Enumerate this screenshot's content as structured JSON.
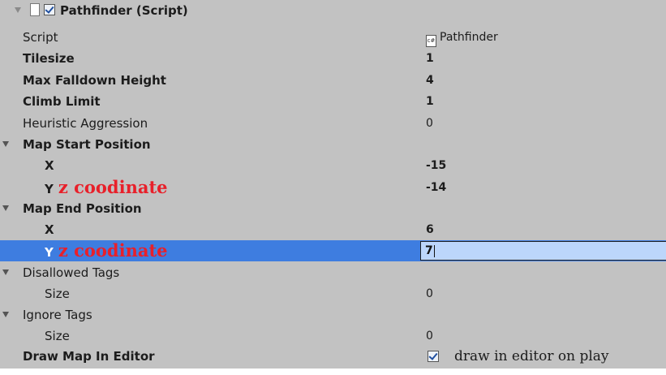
{
  "component": {
    "title": "Pathfinder (Script)"
  },
  "rows": {
    "script": {
      "label": "Script",
      "value": "Pathfinder"
    },
    "tilesize": {
      "label": "Tilesize",
      "value": "1"
    },
    "max_falldown": {
      "label": "Max Falldown Height",
      "value": "4"
    },
    "climb_limit": {
      "label": "Climb Limit",
      "value": "1"
    },
    "heuristic": {
      "label": "Heuristic Aggression",
      "value": "0"
    },
    "map_start": {
      "label": "Map Start Position"
    },
    "start_x": {
      "label": "X",
      "value": "-15"
    },
    "start_y": {
      "label": "Y",
      "value": "-14",
      "note": "z coodinate"
    },
    "map_end": {
      "label": "Map End Position"
    },
    "end_x": {
      "label": "X",
      "value": "6"
    },
    "end_y": {
      "label": "Y",
      "value": "7",
      "note": "z coodinate"
    },
    "disallowed_tags": {
      "label": "Disallowed Tags"
    },
    "disallowed_size": {
      "label": "Size",
      "value": "0"
    },
    "ignore_tags": {
      "label": "Ignore Tags"
    },
    "ignore_size": {
      "label": "Size",
      "value": "0"
    },
    "draw_map": {
      "label": "Draw Map In Editor",
      "checked": true,
      "note": "draw in editor on play"
    }
  },
  "colors": {
    "panel": "#c2c2c2",
    "selection": "#3e7de0",
    "annotation": "#e8202a",
    "input_bg": "#bcd6fb"
  }
}
